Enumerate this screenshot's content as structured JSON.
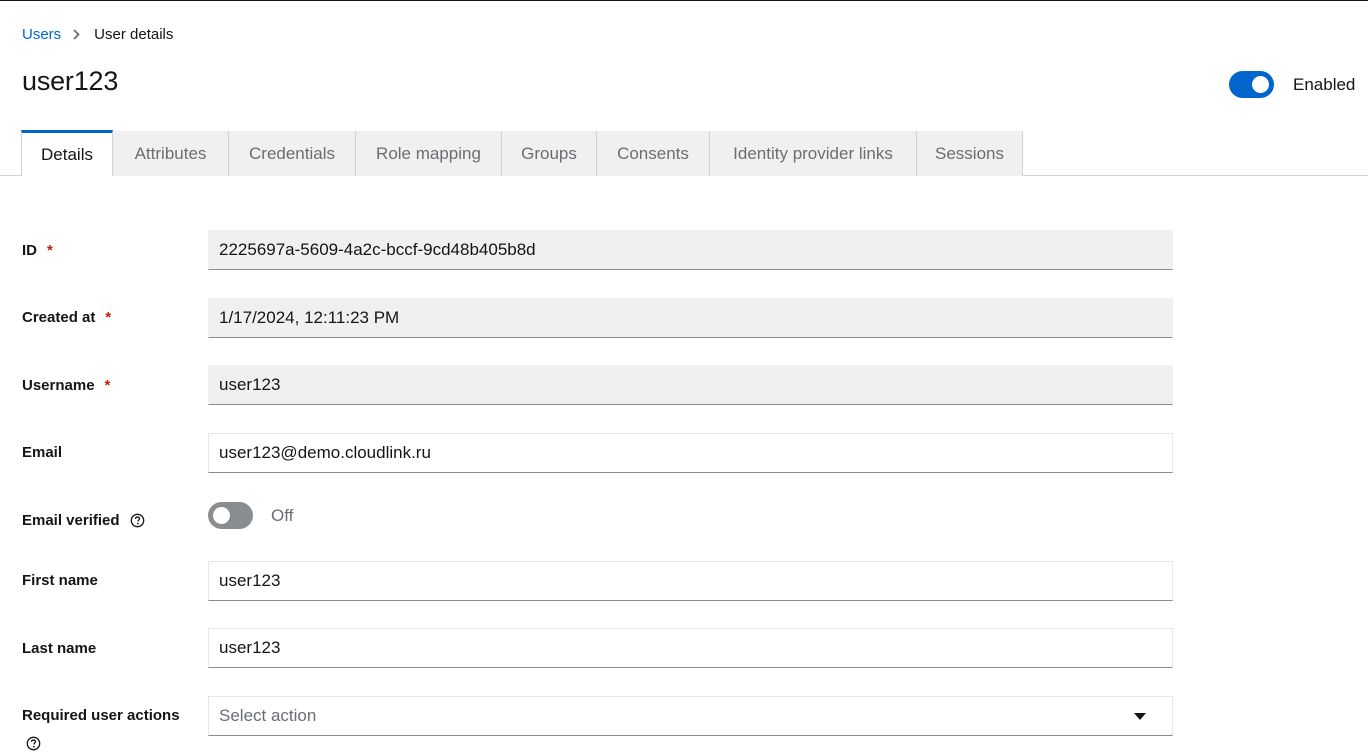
{
  "breadcrumb": {
    "parent": "Users",
    "current": "User details"
  },
  "header": {
    "title": "user123",
    "enabled_label": "Enabled",
    "enabled": true
  },
  "tabs": [
    {
      "label": "Details",
      "active": true
    },
    {
      "label": "Attributes",
      "active": false
    },
    {
      "label": "Credentials",
      "active": false
    },
    {
      "label": "Role mapping",
      "active": false
    },
    {
      "label": "Groups",
      "active": false
    },
    {
      "label": "Consents",
      "active": false
    },
    {
      "label": "Identity provider links",
      "active": false
    },
    {
      "label": "Sessions",
      "active": false
    }
  ],
  "form": {
    "id": {
      "label": "ID",
      "required_mark": "*",
      "value": "2225697a-5609-4a2c-bccf-9cd48b405b8d"
    },
    "created_at": {
      "label": "Created at",
      "required_mark": "*",
      "value": "1/17/2024, 12:11:23 PM"
    },
    "username": {
      "label": "Username",
      "required_mark": "*",
      "value": "user123"
    },
    "email": {
      "label": "Email",
      "value": "user123@demo.cloudlink.ru"
    },
    "email_verified": {
      "label": "Email verified",
      "state_label": "Off",
      "enabled": false
    },
    "first_name": {
      "label": "First name",
      "value": "user123"
    },
    "last_name": {
      "label": "Last name",
      "value": "user123"
    },
    "required_actions": {
      "label": "Required user actions",
      "placeholder": "Select action"
    }
  },
  "colors": {
    "accent": "#0066cc",
    "required": "#c9190b",
    "readonly_bg": "#f0f0f0"
  }
}
